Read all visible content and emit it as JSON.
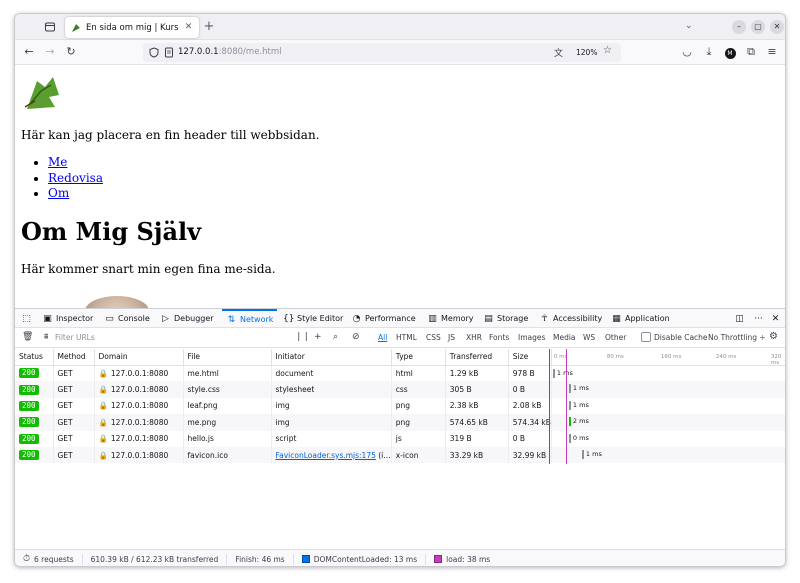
{
  "browser": {
    "tab_title": "En sida om mig | Kursen v",
    "url_host": "127.0.0.1",
    "url_rest": ":8080/me.html",
    "zoom": "120%"
  },
  "page": {
    "header_text": "Här kan jag placera en fin header till webbsidan.",
    "nav": [
      "Me",
      "Redovisa",
      "Om"
    ],
    "heading": "Om Mig Själv",
    "intro": "Här kommer snart min egen fina me-sida."
  },
  "devtools": {
    "tabs": [
      {
        "label": "Inspector",
        "icon": "inspector-icon"
      },
      {
        "label": "Console",
        "icon": "console-icon"
      },
      {
        "label": "Debugger",
        "icon": "debugger-icon"
      },
      {
        "label": "Network",
        "icon": "network-icon"
      },
      {
        "label": "Style Editor",
        "icon": "style-editor-icon"
      },
      {
        "label": "Performance",
        "icon": "performance-icon"
      },
      {
        "label": "Memory",
        "icon": "memory-icon"
      },
      {
        "label": "Storage",
        "icon": "storage-icon"
      },
      {
        "label": "Accessibility",
        "icon": "accessibility-icon"
      },
      {
        "label": "Application",
        "icon": "application-icon"
      }
    ],
    "active_tab": "Network",
    "filter_placeholder": "Filter URLs",
    "type_filters": [
      "All",
      "HTML",
      "CSS",
      "JS",
      "XHR",
      "Fonts",
      "Images",
      "Media",
      "WS",
      "Other"
    ],
    "disable_cache": "Disable Cache",
    "throttling": "No Throttling ÷",
    "columns": [
      "Status",
      "Method",
      "Domain",
      "File",
      "Initiator",
      "Type",
      "Transferred",
      "Size"
    ],
    "timeline_ticks": [
      "0 ms",
      "80 ms",
      "160 ms",
      "240 ms",
      "320 ms"
    ],
    "requests": [
      {
        "status": "200",
        "method": "GET",
        "domain": "127.0.0.1:8080",
        "file": "me.html",
        "initiator": "document",
        "type": "html",
        "transferred": "1.29 kB",
        "size": "978 B",
        "time": "1 ms"
      },
      {
        "status": "200",
        "method": "GET",
        "domain": "127.0.0.1:8080",
        "file": "style.css",
        "initiator": "stylesheet",
        "type": "css",
        "transferred": "305 B",
        "size": "0 B",
        "time": "1 ms"
      },
      {
        "status": "200",
        "method": "GET",
        "domain": "127.0.0.1:8080",
        "file": "leaf.png",
        "initiator": "img",
        "type": "png",
        "transferred": "2.38 kB",
        "size": "2.08 kB",
        "time": "1 ms"
      },
      {
        "status": "200",
        "method": "GET",
        "domain": "127.0.0.1:8080",
        "file": "me.png",
        "initiator": "img",
        "type": "png",
        "transferred": "574.65 kB",
        "size": "574.34 kB",
        "time": "2 ms"
      },
      {
        "status": "200",
        "method": "GET",
        "domain": "127.0.0.1:8080",
        "file": "hello.js",
        "initiator": "script",
        "type": "js",
        "transferred": "319 B",
        "size": "0 B",
        "time": "0 ms"
      },
      {
        "status": "200",
        "method": "GET",
        "domain": "127.0.0.1:8080",
        "file": "favicon.ico",
        "initiator": "FaviconLoader.sys.mjs:175",
        "initiator_suffix": " (i…",
        "type": "x-icon",
        "transferred": "33.29 kB",
        "size": "32.99 kB",
        "time": "1 ms"
      }
    ],
    "summary": {
      "requests": "6 requests",
      "transferred": "610.39 kB / 612.23 kB transferred",
      "finish": "Finish: 46 ms",
      "dom_loaded": "DOMContentLoaded: 13 ms",
      "load": "load: 38 ms"
    },
    "colors": {
      "dom_loaded": "#0074e8",
      "load": "#c63cb8",
      "status_ok": "#12bc00"
    }
  }
}
